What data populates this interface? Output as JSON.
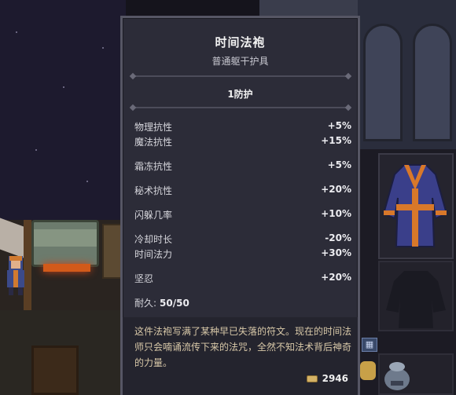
{
  "tooltip": {
    "title": "时间法袍",
    "subtitle": "普通躯干护具",
    "defense": "1防护",
    "stats": [
      {
        "name": "物理抗性",
        "value": "+5%"
      },
      {
        "name": "魔法抗性",
        "value": "+15%"
      },
      {
        "name": "霜冻抗性",
        "value": "+5%"
      },
      {
        "name": "秘术抗性",
        "value": "+20%"
      },
      {
        "name": "闪躲几率",
        "value": "+10%"
      },
      {
        "name": "冷却时长",
        "value": "-20%"
      },
      {
        "name": "时间法力",
        "value": "+30%"
      },
      {
        "name": "坚忍",
        "value": "+20%"
      }
    ],
    "durability_label": "耐久:",
    "durability_value": "50/50",
    "description": "这件法袍写满了某种早已失落的符文。现在的时间法师只会喃诵流传下来的法咒，全然不知法术背后神奇的力量。",
    "price": "2946"
  },
  "icons": {
    "coin": "gold-coins-icon",
    "robe": "time-robe-icon",
    "bag": "bag-icon",
    "grid": "grid-icon"
  },
  "colors": {
    "tooltip_bg": "#2c2c38",
    "description_text": "#d8c8a8",
    "robe_primary": "#3a3f8a",
    "robe_trim": "#d8782a"
  }
}
